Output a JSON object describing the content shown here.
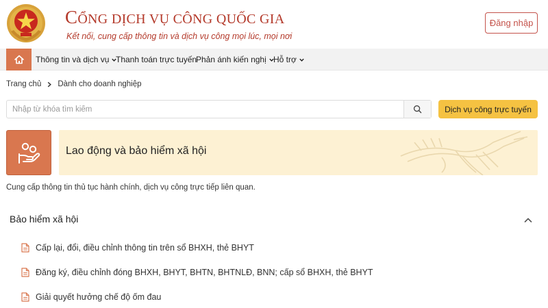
{
  "header": {
    "title_initial": "C",
    "title_rest": "ỔNG DỊCH VỤ CÔNG QUỐC GIA",
    "subtitle": "Kết nối, cung cấp thông tin và dịch vụ công mọi lúc, mọi nơi",
    "login_label": "Đăng nhập"
  },
  "nav": {
    "items": [
      {
        "label": "Thông tin và dịch vụ",
        "has_dropdown": true
      },
      {
        "label": "Thanh toán trực tuyến",
        "has_dropdown": false
      },
      {
        "label": "Phản ánh kiến nghị",
        "has_dropdown": true
      },
      {
        "label": "Hỗ trợ",
        "has_dropdown": true
      }
    ]
  },
  "breadcrumb": {
    "items": [
      "Trang chủ",
      "Dành cho doanh nghiệp"
    ]
  },
  "search": {
    "placeholder": "Nhập từ khóa tìm kiếm",
    "value": ""
  },
  "service_button_label": "Dịch vụ công trực tuyến",
  "category": {
    "title": "Lao động và bảo hiểm xã hội",
    "description": "Cung cấp thông tin thủ tục hành chính, dịch vụ công trực tiếp liên quan.",
    "icon": "hand-coins-icon"
  },
  "accordion": {
    "title": "Bảo hiểm xã hội",
    "expanded": true,
    "items": [
      "Cấp lại, đổi, điều chỉnh thông tin trên sổ BHXH, thẻ BHYT",
      "Đăng ký, điều chỉnh đóng BHXH, BHYT, BHTN, BHTNLĐ, BNN; cấp sổ BHXH, thẻ BHYT",
      "Giải quyết hưởng chế độ ốm đau"
    ]
  },
  "colors": {
    "brand_red": "#b43a2b",
    "accent_orange": "#d9774f",
    "button_yellow": "#f5c242",
    "banner_bg": "#fdf1d3"
  }
}
